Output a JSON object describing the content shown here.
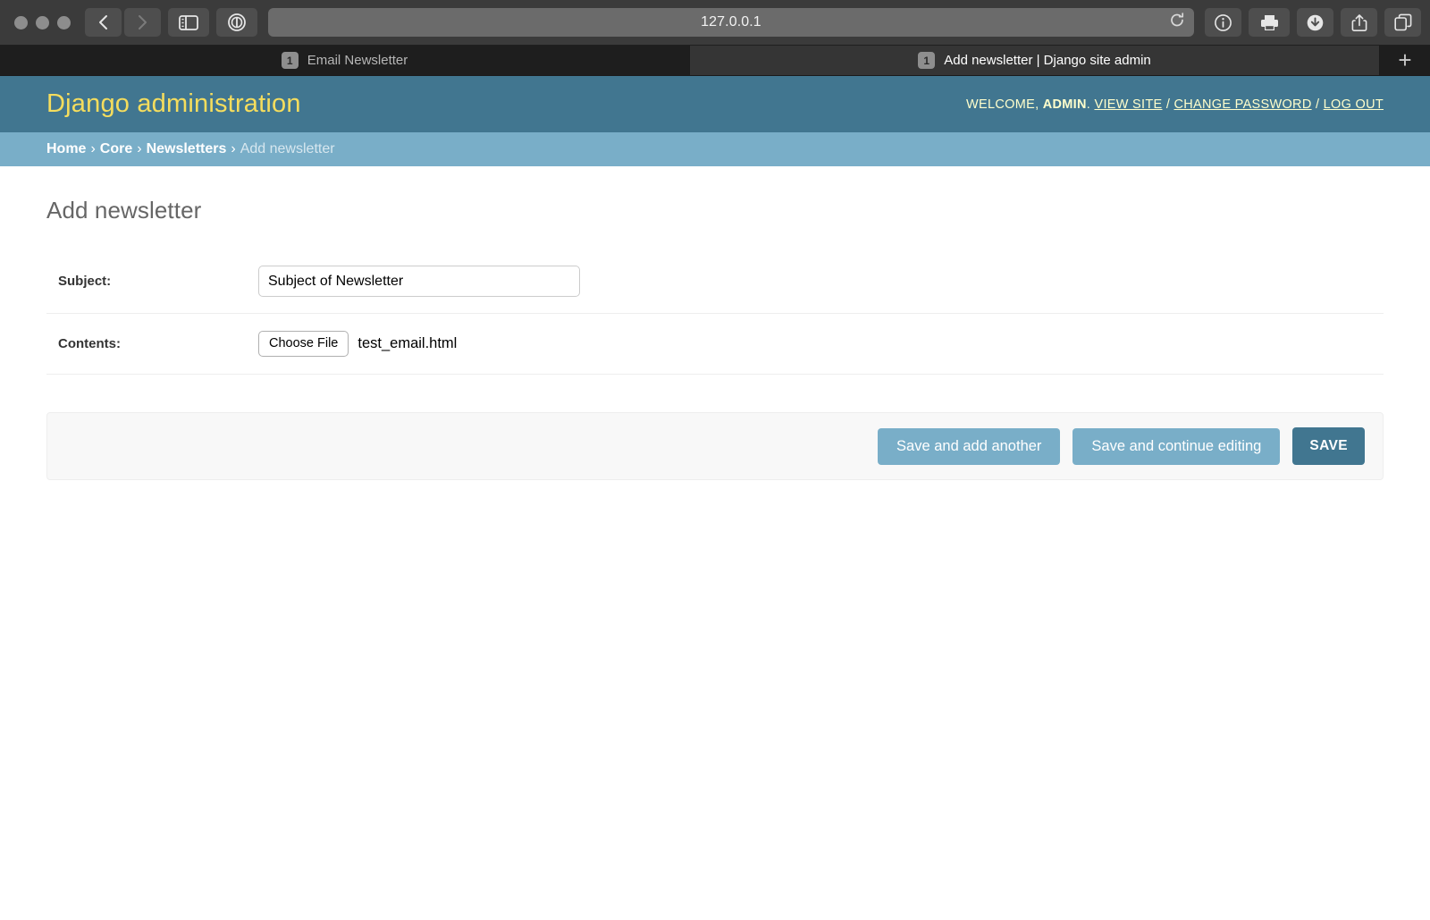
{
  "browser": {
    "url": "127.0.0.1",
    "toolbar_icons": {
      "back": "back-chevron-icon",
      "forward": "forward-chevron-icon",
      "sidebar": "sidebar-toggle-icon",
      "reader": "reader-view-icon",
      "reload": "reload-icon",
      "info": "info-icon",
      "print": "print-icon",
      "download": "download-icon",
      "share": "share-icon",
      "tab_overview": "tab-overview-icon"
    },
    "tabs": [
      {
        "badge": "1",
        "title": "Email Newsletter",
        "active": false
      },
      {
        "badge": "1",
        "title": "Add newsletter | Django site admin",
        "active": true
      }
    ],
    "new_tab_label": "+"
  },
  "admin": {
    "brand": "Django administration",
    "user_tools": {
      "welcome_prefix": "WELCOME,",
      "username": "ADMIN",
      "after_username": ".",
      "view_site": "VIEW SITE",
      "separator": "/",
      "change_password": "CHANGE PASSWORD",
      "log_out": "LOG OUT"
    },
    "breadcrumbs": {
      "home": "Home",
      "core": "Core",
      "newsletters": "Newsletters",
      "current": "Add newsletter",
      "separator": "›"
    },
    "page_title": "Add newsletter",
    "form": {
      "subject": {
        "label": "Subject:",
        "value": "Subject of Newsletter",
        "placeholder": ""
      },
      "contents": {
        "label": "Contents:",
        "choose_file_label": "Choose File",
        "file_name": "test_email.html"
      }
    },
    "submit_row": {
      "save_and_add_another": "Save and add another",
      "save_and_continue": "Save and continue editing",
      "save": "SAVE"
    },
    "colors": {
      "header_bg": "#417690",
      "breadcrumb_bg": "#79aec8",
      "brand_text": "#f5dd5d",
      "button_secondary": "#79aec8",
      "button_primary": "#417690"
    }
  }
}
